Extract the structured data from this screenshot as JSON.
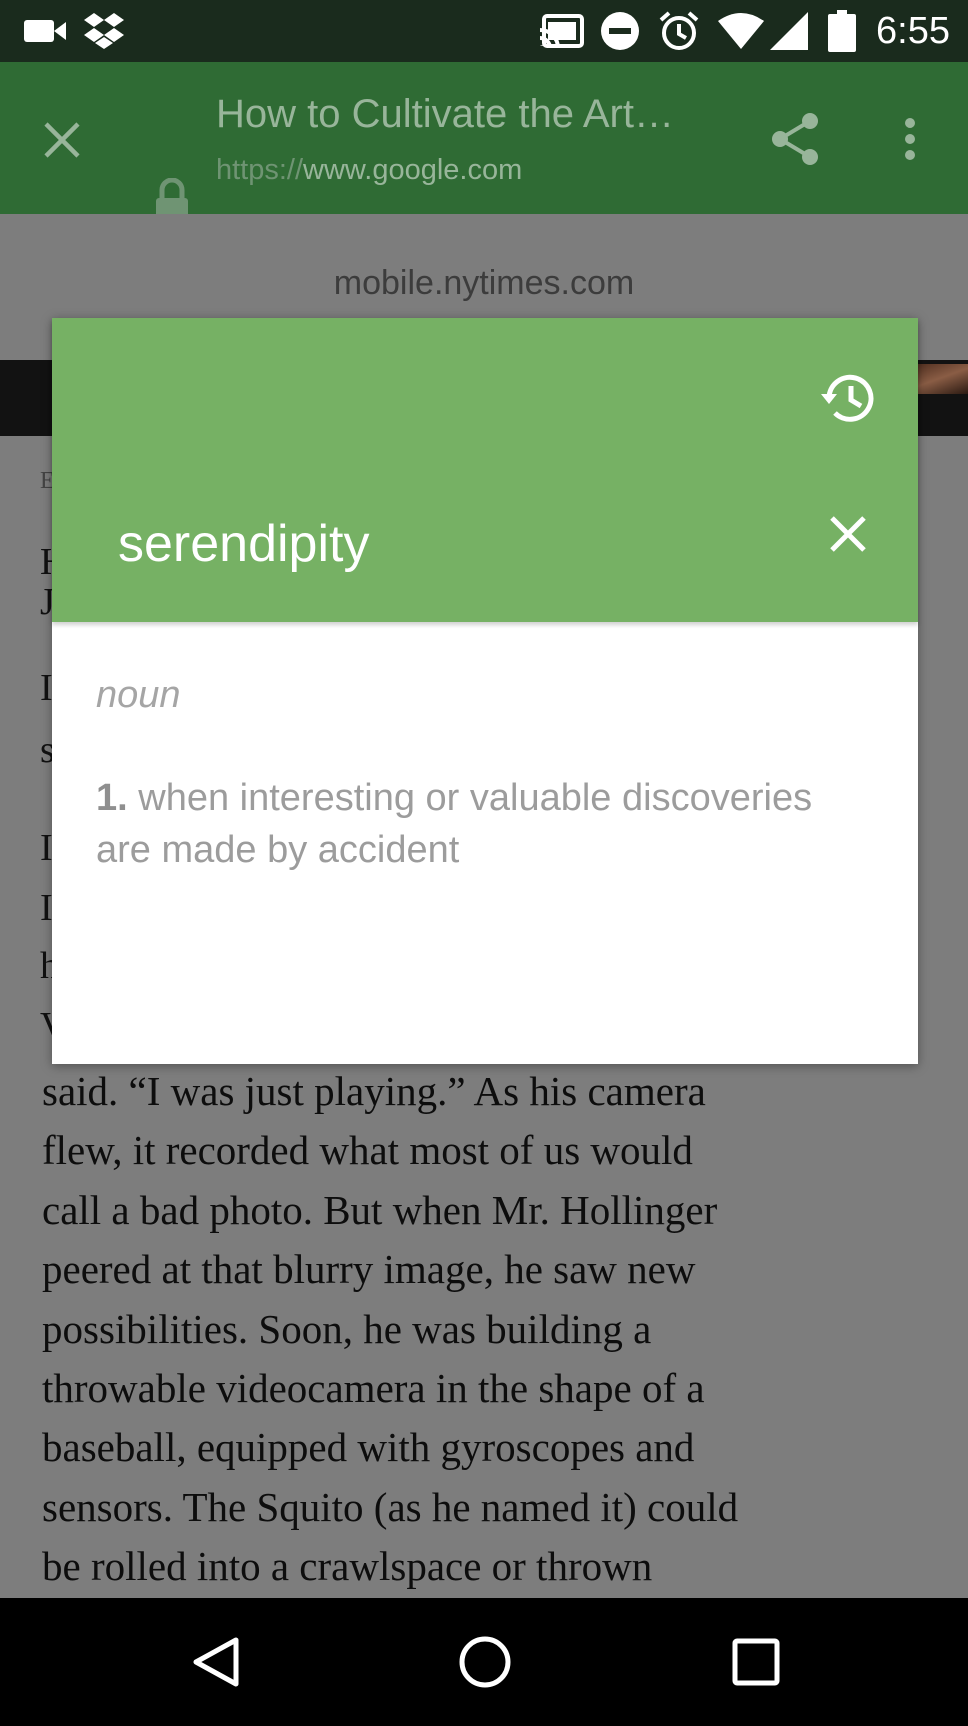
{
  "status_bar": {
    "time": "6:55",
    "icons": [
      "video-camera-icon",
      "dropbox-icon",
      "cast-icon",
      "do-not-disturb-icon",
      "alarm-icon",
      "wifi-icon",
      "signal-icon",
      "battery-icon"
    ]
  },
  "toolbar": {
    "title": "How to Cultivate the Art…",
    "url_scheme": "https://",
    "url_host": "www.google.com",
    "icons": [
      "close-icon",
      "lock-icon",
      "share-icon",
      "more-vert-icon"
    ],
    "color": "#2f6b34"
  },
  "page": {
    "domain": "mobile.nytimes.com",
    "fragments": [
      "E",
      "H",
      "J",
      "I",
      "s",
      "I",
      "I",
      "h",
      "V"
    ],
    "body_lines": [
      "said. “I was just playing.” As his camera",
      "flew, it recorded what most of us would",
      "call a bad photo. But when Mr. Hollinger",
      "peered at that blurry image, he saw new",
      "possibilities. Soon, he was building a",
      "throwable videocamera in the shape of a",
      "baseball, equipped with gyroscopes and",
      "sensors. The Squito (as he named it) could",
      "be rolled into a crawlspace or thrown"
    ]
  },
  "dictionary": {
    "word": "serendipity",
    "part_of_speech": "noun",
    "definition_number": "1.",
    "definition_text": " when interesting or valuable discoveries are made by accident",
    "accent_color": "#76b164",
    "icons": [
      "history-icon",
      "close-icon"
    ]
  },
  "nav_bar": {
    "buttons": [
      "back-icon",
      "home-icon",
      "recents-icon"
    ]
  }
}
